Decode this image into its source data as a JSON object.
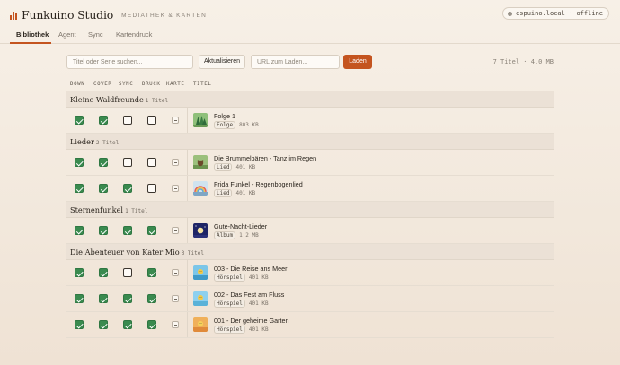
{
  "header": {
    "app_name": "Funkuino Studio",
    "subtitle": "MEDIATHEK & KARTEN",
    "device_label": "espuino.local · offline"
  },
  "tabs": [
    "Bibliothek",
    "Agent",
    "Sync",
    "Kartendruck"
  ],
  "toolbar": {
    "search_placeholder": "Titel oder Serie suchen...",
    "refresh_label": "Aktualisieren",
    "url_placeholder": "URL zum Laden...",
    "load_label": "Laden",
    "stats": "7 Titel · 4.0 MB"
  },
  "columns": [
    "DOWN",
    "COVER",
    "SYNC",
    "DRUCK",
    "KARTE",
    "TITEL"
  ],
  "groups": [
    {
      "name": "Kleine Waldfreunde",
      "count": "1 Titel",
      "rows": [
        {
          "title": "Folge 1",
          "type": "Folge",
          "size": "803 KB",
          "flags": [
            true,
            true,
            false,
            false
          ],
          "thumb": "forest"
        }
      ]
    },
    {
      "name": "Lieder",
      "count": "2 Titel",
      "rows": [
        {
          "title": "Die Brummelbären - Tanz im Regen",
          "type": "Lied",
          "size": "401 KB",
          "flags": [
            true,
            true,
            false,
            false
          ],
          "thumb": "bear"
        },
        {
          "title": "Frida Funkel - Regenbogenlied",
          "type": "Lied",
          "size": "401 KB",
          "flags": [
            true,
            true,
            true,
            false
          ],
          "thumb": "rainbow"
        }
      ]
    },
    {
      "name": "Sternenfunkel",
      "count": "1 Titel",
      "rows": [
        {
          "title": "Gute-Nacht-Lieder",
          "type": "Album",
          "size": "1.2 MB",
          "flags": [
            true,
            true,
            true,
            true
          ],
          "thumb": "night"
        }
      ]
    },
    {
      "name": "Die Abenteuer von Kater Mio",
      "count": "3 Titel",
      "rows": [
        {
          "title": "003 - Die Reise ans Meer",
          "type": "Hörspiel",
          "size": "401 KB",
          "flags": [
            true,
            true,
            false,
            true
          ],
          "thumb": "sea"
        },
        {
          "title": "002 - Das Fest am Fluss",
          "type": "Hörspiel",
          "size": "401 KB",
          "flags": [
            true,
            true,
            true,
            true
          ],
          "thumb": "river"
        },
        {
          "title": "001 - Der geheime Garten",
          "type": "Hörspiel",
          "size": "401 KB",
          "flags": [
            true,
            true,
            true,
            true
          ],
          "thumb": "garden"
        }
      ]
    }
  ],
  "colors": {
    "accent": "#c4541f",
    "check": "#3a8a4f",
    "group_bg": "#ebe1d6"
  }
}
